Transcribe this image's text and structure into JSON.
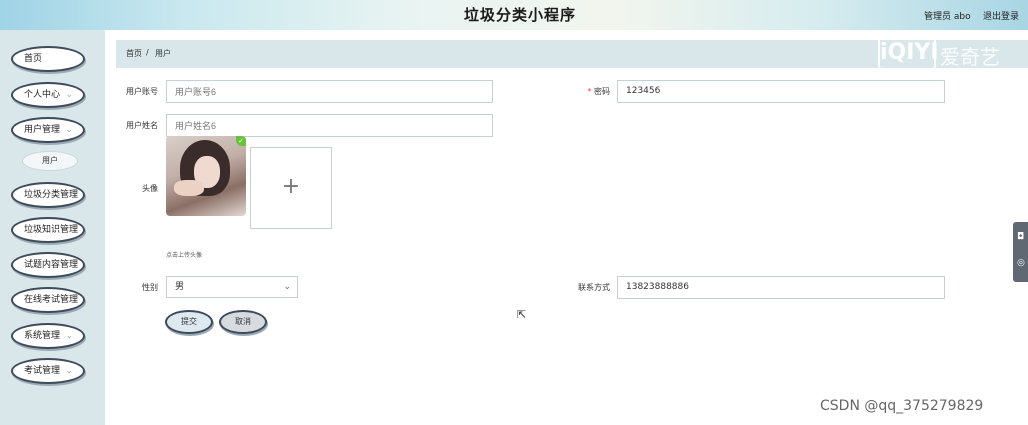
{
  "header": {
    "title": "垃圾分类小程序",
    "user_label": "管理员 abo",
    "logout_label": "退出登录"
  },
  "sidebar": {
    "items": [
      {
        "label": "首页",
        "has_arrow": false
      },
      {
        "label": "个人中心",
        "has_arrow": true
      },
      {
        "label": "用户管理",
        "has_arrow": true
      },
      {
        "label": "垃圾分类管理",
        "has_arrow": false
      },
      {
        "label": "垃圾知识管理",
        "has_arrow": false
      },
      {
        "label": "试题内容管理",
        "has_arrow": false
      },
      {
        "label": "在线考试管理",
        "has_arrow": false
      },
      {
        "label": "系统管理",
        "has_arrow": true
      },
      {
        "label": "考试管理",
        "has_arrow": true
      }
    ],
    "active_sub_item": "用户",
    "chevron_glyph": "⌄"
  },
  "breadcrumb": {
    "home": "首页",
    "separator": "/",
    "current": "用户"
  },
  "watermark": {
    "logo_text": "iQIYI",
    "cn_text": "爱奇艺",
    "csdn": "CSDN @qq_375279829"
  },
  "form": {
    "account": {
      "label": "用户账号",
      "placeholder": "用户账号6"
    },
    "password": {
      "label": "密码",
      "required_mark": "*",
      "value": "123456"
    },
    "name": {
      "label": "用户姓名",
      "placeholder": "用户姓名6"
    },
    "avatar": {
      "label": "头像",
      "upload_tip": "点击上传头像",
      "upload_glyph": "+",
      "check_glyph": "✓"
    },
    "gender": {
      "label": "性别",
      "value": "男",
      "arrow_glyph": "⌄"
    },
    "phone": {
      "label": "联系方式",
      "value": "13823888886"
    },
    "submit_label": "提交",
    "cancel_label": "取消"
  },
  "side_tools": {
    "camera_glyph": "◘",
    "location_glyph": "◎"
  },
  "cursor_glyph": "⇱"
}
